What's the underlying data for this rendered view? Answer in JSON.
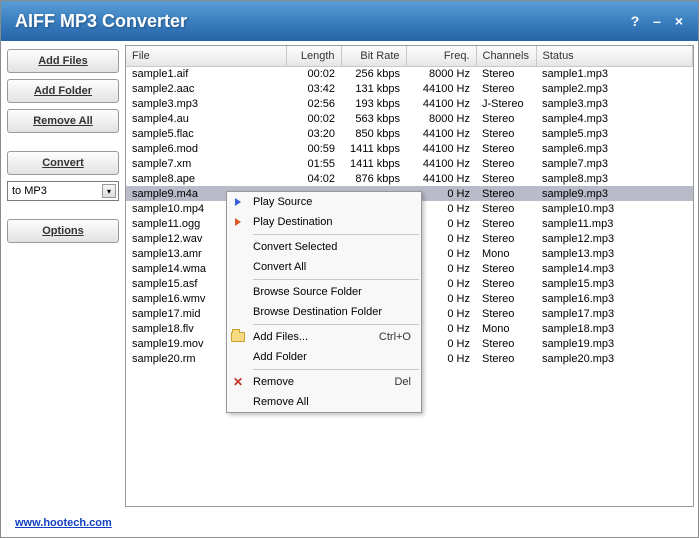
{
  "window": {
    "title": "AIFF MP3 Converter"
  },
  "sidebar": {
    "add_files": "Add Files",
    "add_folder": "Add Folder",
    "remove_all": "Remove All",
    "convert": "Convert",
    "format": "to MP3",
    "options": "Options"
  },
  "columns": {
    "file": "File",
    "length": "Length",
    "bitrate": "Bit Rate",
    "freq": "Freq.",
    "channels": "Channels",
    "status": "Status"
  },
  "rows": [
    {
      "file": "sample1.aif",
      "length": "00:02",
      "bitrate": "256 kbps",
      "freq": "8000 Hz",
      "channels": "Stereo",
      "status": "sample1.mp3",
      "sel": false
    },
    {
      "file": "sample2.aac",
      "length": "03:42",
      "bitrate": "131 kbps",
      "freq": "44100 Hz",
      "channels": "Stereo",
      "status": "sample2.mp3",
      "sel": false
    },
    {
      "file": "sample3.mp3",
      "length": "02:56",
      "bitrate": "193 kbps",
      "freq": "44100 Hz",
      "channels": "J-Stereo",
      "status": "sample3.mp3",
      "sel": false
    },
    {
      "file": "sample4.au",
      "length": "00:02",
      "bitrate": "563 kbps",
      "freq": "8000 Hz",
      "channels": "Stereo",
      "status": "sample4.mp3",
      "sel": false
    },
    {
      "file": "sample5.flac",
      "length": "03:20",
      "bitrate": "850 kbps",
      "freq": "44100 Hz",
      "channels": "Stereo",
      "status": "sample5.mp3",
      "sel": false
    },
    {
      "file": "sample6.mod",
      "length": "00:59",
      "bitrate": "1411 kbps",
      "freq": "44100 Hz",
      "channels": "Stereo",
      "status": "sample6.mp3",
      "sel": false
    },
    {
      "file": "sample7.xm",
      "length": "01:55",
      "bitrate": "1411 kbps",
      "freq": "44100 Hz",
      "channels": "Stereo",
      "status": "sample7.mp3",
      "sel": false
    },
    {
      "file": "sample8.ape",
      "length": "04:02",
      "bitrate": "876 kbps",
      "freq": "44100 Hz",
      "channels": "Stereo",
      "status": "sample8.mp3",
      "sel": false
    },
    {
      "file": "sample9.m4a",
      "length": "",
      "bitrate": "",
      "freq": "0 Hz",
      "channels": "Stereo",
      "status": "sample9.mp3",
      "sel": true
    },
    {
      "file": "sample10.mp4",
      "length": "",
      "bitrate": "",
      "freq": "0 Hz",
      "channels": "Stereo",
      "status": "sample10.mp3",
      "sel": false
    },
    {
      "file": "sample11.ogg",
      "length": "",
      "bitrate": "",
      "freq": "0 Hz",
      "channels": "Stereo",
      "status": "sample11.mp3",
      "sel": false
    },
    {
      "file": "sample12.wav",
      "length": "",
      "bitrate": "",
      "freq": "0 Hz",
      "channels": "Stereo",
      "status": "sample12.mp3",
      "sel": false
    },
    {
      "file": "sample13.amr",
      "length": "",
      "bitrate": "",
      "freq": "0 Hz",
      "channels": "Mono",
      "status": "sample13.mp3",
      "sel": false
    },
    {
      "file": "sample14.wma",
      "length": "",
      "bitrate": "",
      "freq": "0 Hz",
      "channels": "Stereo",
      "status": "sample14.mp3",
      "sel": false
    },
    {
      "file": "sample15.asf",
      "length": "",
      "bitrate": "",
      "freq": "0 Hz",
      "channels": "Stereo",
      "status": "sample15.mp3",
      "sel": false
    },
    {
      "file": "sample16.wmv",
      "length": "",
      "bitrate": "",
      "freq": "0 Hz",
      "channels": "Stereo",
      "status": "sample16.mp3",
      "sel": false
    },
    {
      "file": "sample17.mid",
      "length": "",
      "bitrate": "",
      "freq": "0 Hz",
      "channels": "Stereo",
      "status": "sample17.mp3",
      "sel": false
    },
    {
      "file": "sample18.flv",
      "length": "",
      "bitrate": "",
      "freq": "0 Hz",
      "channels": "Mono",
      "status": "sample18.mp3",
      "sel": false
    },
    {
      "file": "sample19.mov",
      "length": "",
      "bitrate": "",
      "freq": "0 Hz",
      "channels": "Stereo",
      "status": "sample19.mp3",
      "sel": false
    },
    {
      "file": "sample20.rm",
      "length": "",
      "bitrate": "",
      "freq": "0 Hz",
      "channels": "Stereo",
      "status": "sample20.mp3",
      "sel": false
    }
  ],
  "menu": {
    "play_source": "Play Source",
    "play_destination": "Play Destination",
    "convert_selected": "Convert Selected",
    "convert_all": "Convert All",
    "browse_source": "Browse Source Folder",
    "browse_dest": "Browse Destination Folder",
    "add_files": "Add Files...",
    "add_files_sc": "Ctrl+O",
    "add_folder": "Add Folder",
    "remove": "Remove",
    "remove_sc": "Del",
    "remove_all": "Remove All"
  },
  "footer": {
    "link": "www.hootech.com"
  }
}
